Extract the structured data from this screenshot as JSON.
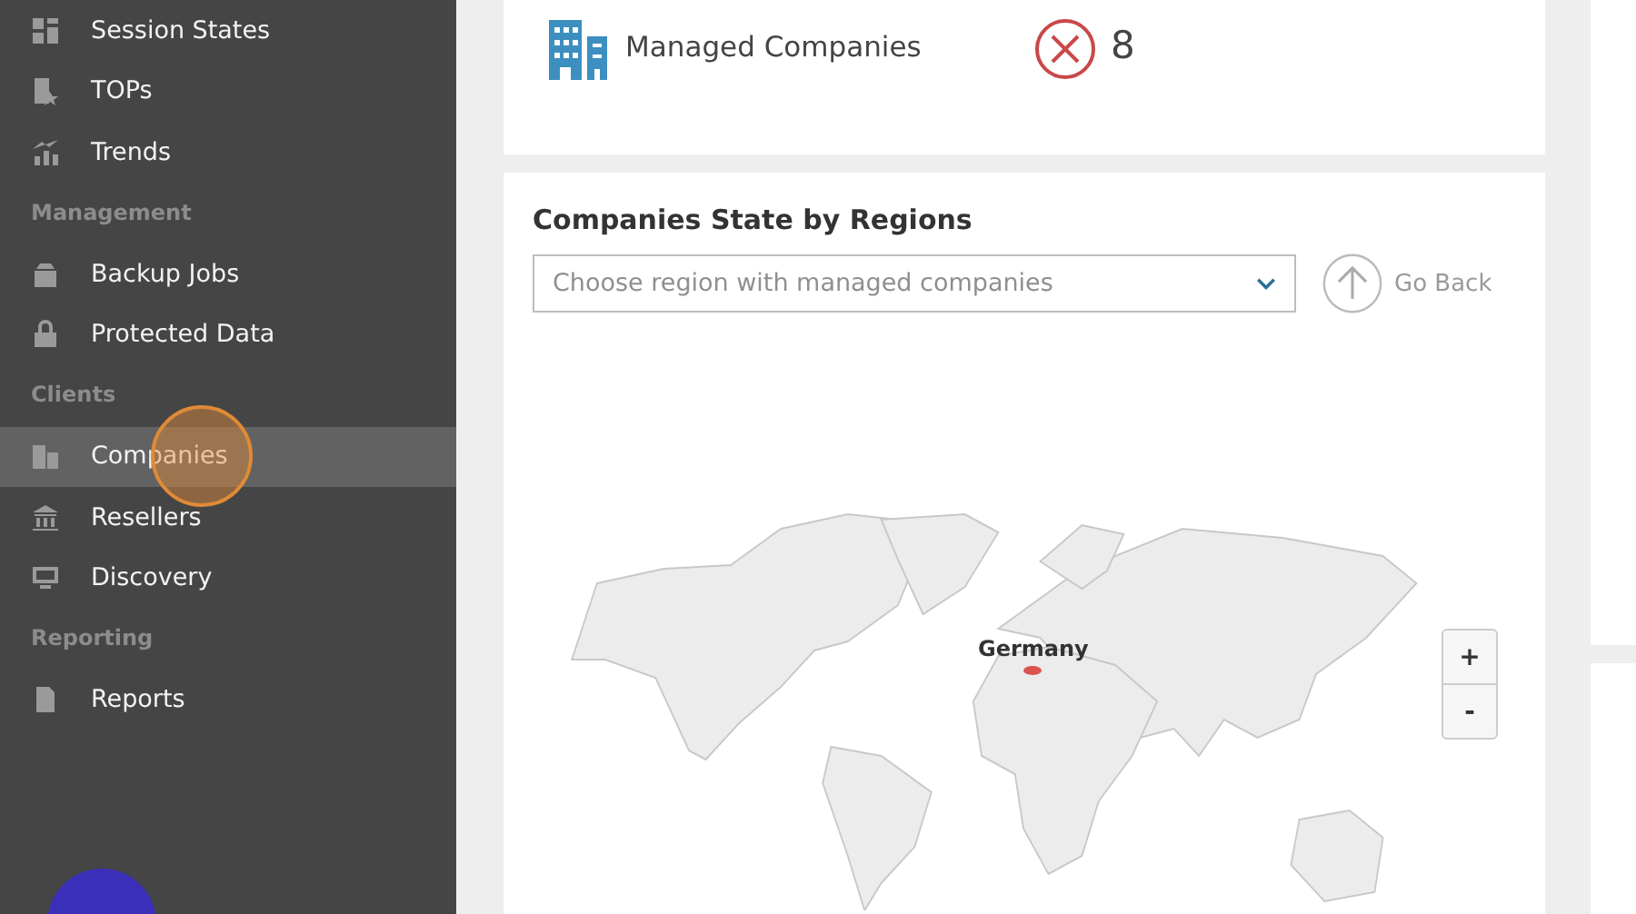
{
  "sidebar": {
    "items": [
      {
        "kind": "item",
        "label": "Session States",
        "selected": false
      },
      {
        "kind": "item",
        "label": "TOPs",
        "selected": false
      },
      {
        "kind": "item",
        "label": "Trends",
        "selected": false
      },
      {
        "kind": "section",
        "label": "Management"
      },
      {
        "kind": "item",
        "label": "Backup Jobs",
        "selected": false
      },
      {
        "kind": "item",
        "label": "Protected Data",
        "selected": false
      },
      {
        "kind": "section",
        "label": "Clients"
      },
      {
        "kind": "item",
        "label": "Companies",
        "selected": true
      },
      {
        "kind": "item",
        "label": "Resellers",
        "selected": false
      },
      {
        "kind": "item",
        "label": "Discovery",
        "selected": false
      },
      {
        "kind": "section",
        "label": "Reporting"
      },
      {
        "kind": "item",
        "label": "Reports",
        "selected": false
      }
    ]
  },
  "summary": {
    "label": "Managed Companies",
    "error": true,
    "count": "8"
  },
  "map_card": {
    "title": "Companies State by Regions",
    "region_select": {
      "placeholder": "Choose region with managed companies"
    },
    "go_back": "Go Back",
    "map": {
      "highlight_label": "Germany"
    },
    "zoom_in": "+",
    "zoom_out": "-"
  }
}
